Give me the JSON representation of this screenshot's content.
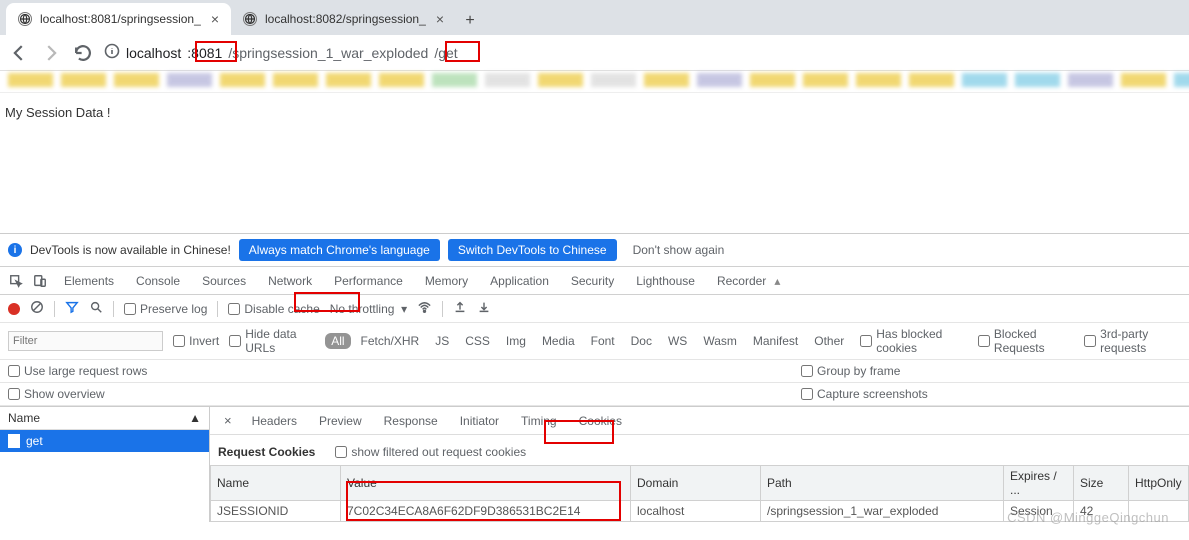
{
  "tabs": [
    {
      "title": "localhost:8081/springsession_"
    },
    {
      "title": "localhost:8082/springsession_"
    }
  ],
  "url": {
    "host": "localhost",
    "port": ":8081",
    "path1": "/springsession_1_war_exploded",
    "path2": "/get"
  },
  "page": {
    "text": "My Session Data !"
  },
  "banner": {
    "msg": "DevTools is now available in Chinese!",
    "btn1": "Always match Chrome's language",
    "btn2": "Switch DevTools to Chinese",
    "btn3": "Don't show again"
  },
  "devtabs": [
    "Elements",
    "Console",
    "Sources",
    "Network",
    "Performance",
    "Memory",
    "Application",
    "Security",
    "Lighthouse",
    "Recorder"
  ],
  "toolbar": {
    "preserve": "Preserve log",
    "disable": "Disable cache",
    "throttle": "No throttling"
  },
  "filters": {
    "placeholder": "Filter",
    "invert": "Invert",
    "hideurls": "Hide data URLs",
    "types": [
      "All",
      "Fetch/XHR",
      "JS",
      "CSS",
      "Img",
      "Media",
      "Font",
      "Doc",
      "WS",
      "Wasm",
      "Manifest",
      "Other"
    ],
    "blocked": "Has blocked cookies",
    "blockedreq": "Blocked Requests",
    "thirdparty": "3rd-party requests"
  },
  "opts": {
    "large": "Use large request rows",
    "overview": "Show overview",
    "group": "Group by frame",
    "capture": "Capture screenshots"
  },
  "reqlist": {
    "hdr": "Name",
    "item": "get"
  },
  "detail_tabs": [
    "Headers",
    "Preview",
    "Response",
    "Initiator",
    "Timing",
    "Cookies"
  ],
  "rc": {
    "title": "Request Cookies",
    "filteredout": "show filtered out request cookies"
  },
  "cookie_cols": [
    "Name",
    "Value",
    "Domain",
    "Path",
    "Expires / ...",
    "Size",
    "HttpOnly"
  ],
  "cookie_row": {
    "name": "JSESSIONID",
    "value": "7C02C34ECA8A6F62DF9D386531BC2E14",
    "domain": "localhost",
    "path": "/springsession_1_war_exploded",
    "expires": "Session",
    "size": "42",
    "httponly": ""
  },
  "watermark": "CSDN @MinggeQingchun",
  "bm_colors": [
    "#e6b800",
    "#e6b800",
    "#e6b800",
    "#99c",
    "#e6b800",
    "#e6b800",
    "#e6b800",
    "#e6b800",
    "#8c8",
    "#ccc",
    "#e6b800",
    "#ccc",
    "#e6b800",
    "#99c",
    "#e6b800",
    "#e6b800",
    "#e6b800",
    "#e6b800",
    "#5bd",
    "#5bd",
    "#99c",
    "#e6b800",
    "#5bd",
    "#d46"
  ]
}
